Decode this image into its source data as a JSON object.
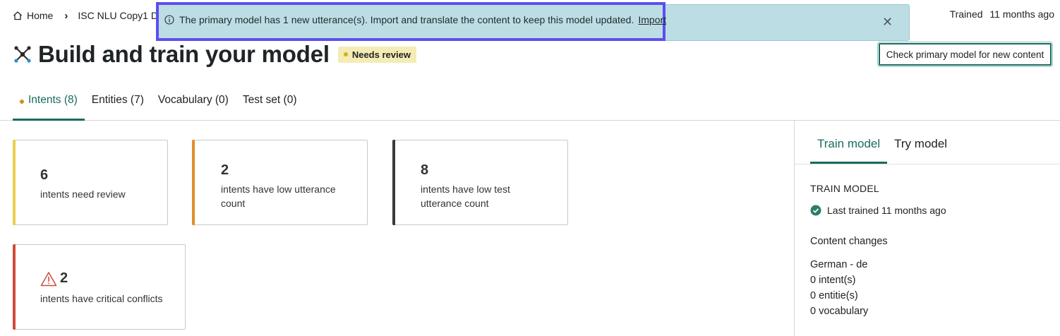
{
  "breadcrumb": {
    "home": "Home",
    "current": "ISC NLU Copy1 DE -"
  },
  "trained_status": {
    "label": "Trained",
    "value": "11 months ago"
  },
  "banner": {
    "message": "The primary model has 1 new utterance(s). Import and translate the content to keep this model updated.",
    "link": "Import",
    "close": "✕"
  },
  "header": {
    "title": "Build and train your model",
    "badge": "Needs review",
    "action_button": "Check primary model for new content"
  },
  "tabs": [
    {
      "label": "Intents (8)"
    },
    {
      "label": "Entities (7)"
    },
    {
      "label": "Vocabulary (0)"
    },
    {
      "label": "Test set (0)"
    }
  ],
  "cards": [
    {
      "value": "6",
      "desc": "intents need review",
      "color": "#e6d04a"
    },
    {
      "value": "2",
      "desc": "intents have low utterance count",
      "color": "#e0902c"
    },
    {
      "value": "8",
      "desc": "intents have low test utterance count",
      "color": "#3a3a3a"
    },
    {
      "value": "2",
      "desc": "intents have critical conflicts",
      "color": "#d04a3a",
      "icon": "warning-icon"
    }
  ],
  "panel": {
    "tabs": [
      {
        "label": "Train model"
      },
      {
        "label": "Try model"
      }
    ],
    "heading": "TRAIN MODEL",
    "last_trained": "Last trained 11 months ago",
    "changes_title": "Content changes",
    "language": "German - de",
    "intents": "0 intent(s)",
    "entities": "0 entitie(s)",
    "vocabulary": "0 vocabulary"
  },
  "colors": {
    "accent": "#1a6b5e",
    "banner": "#bddde4",
    "highlight_outline": "#5b4ff0",
    "badge": "#f4ecb4"
  }
}
